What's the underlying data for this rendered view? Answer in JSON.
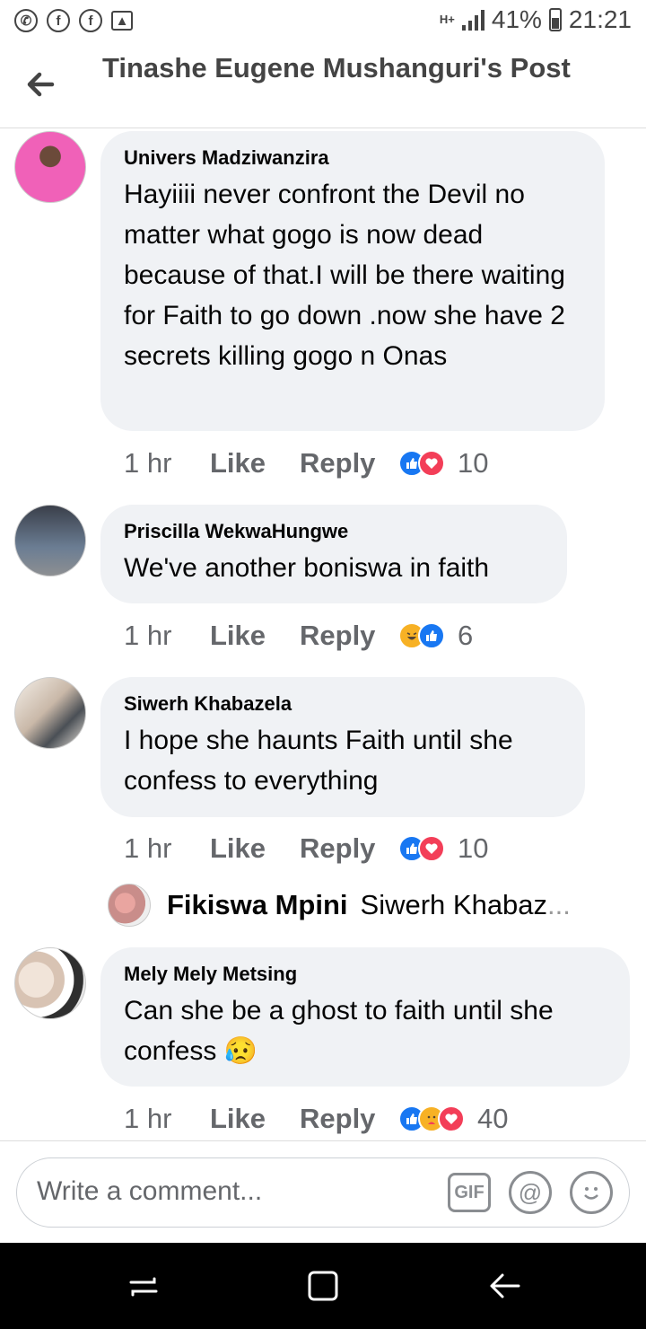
{
  "status_bar": {
    "left_icons": [
      "whatsapp-icon",
      "facebook-icon",
      "facebook-icon",
      "image-icon"
    ],
    "network": "H+",
    "battery": "41%",
    "time": "21:21"
  },
  "header": {
    "title": "Tinashe Eugene  Mushanguri's Post"
  },
  "comments": [
    {
      "author": "Univers Madziwanzira",
      "text": "Hayiiii never confront the Devil  no matter what gogo is now dead because of that.I will be there waiting for Faith to go down .now she have 2 secrets killing gogo n Onas",
      "time": "1 hr",
      "like": "Like",
      "reply": "Reply",
      "reactions": [
        "like",
        "love"
      ],
      "count": "10"
    },
    {
      "author": "Priscilla WekwaHungwe",
      "text": "We've another boniswa in faith",
      "time": "1 hr",
      "like": "Like",
      "reply": "Reply",
      "reactions": [
        "haha",
        "like"
      ],
      "count": "6"
    },
    {
      "author": "Siwerh Khabazela",
      "text": "I hope she haunts Faith until she confess to everything",
      "time": "1 hr",
      "like": "Like",
      "reply": "Reply",
      "reactions": [
        "like",
        "love"
      ],
      "count": "10"
    },
    {
      "author": "Mely Mely Metsing",
      "text": "Can she be a ghost to faith until she confess 😥",
      "time": "1 hr",
      "like": "Like",
      "reply": "Reply",
      "reactions": [
        "like",
        "care",
        "love"
      ],
      "count": "40"
    }
  ],
  "sub_reply": {
    "author": "Fikiswa Mpini",
    "text": "Siwerh Khabaz",
    "ellipsis": "..."
  },
  "composer": {
    "placeholder": "Write a comment...",
    "gif_label": "GIF",
    "mention_symbol": "@"
  },
  "colors": {
    "bubble": "#f0f2f5",
    "like_blue": "#1877f2",
    "love_red": "#f33e58",
    "haha_yellow": "#f7b125"
  }
}
